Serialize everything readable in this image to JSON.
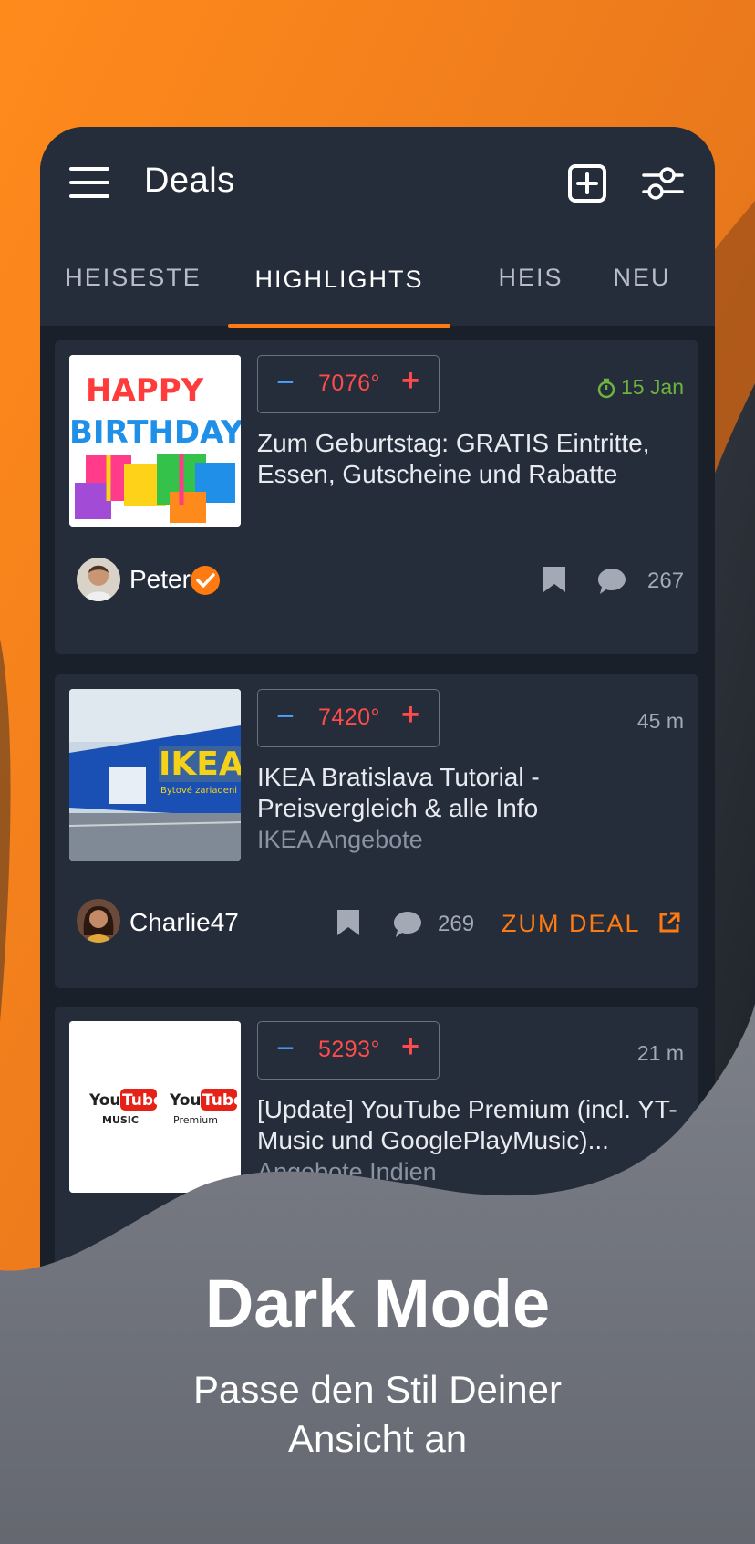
{
  "app": {
    "title": "Deals"
  },
  "tabs": [
    {
      "label": "HEISESTE"
    },
    {
      "label": "HIGHLIGHTS",
      "active": true
    },
    {
      "label": "HEIS"
    },
    {
      "label": "NEU"
    }
  ],
  "deals": [
    {
      "temperature": "7076°",
      "time": "15 Jan",
      "time_has_timer_icon": true,
      "title": "Zum Geburtstag: GRATIS Eintritte, Essen, Gutscheine und Rabatte",
      "thumb_text": [
        "HAPPY",
        "BIRTHDAY"
      ],
      "user": "Peter",
      "verified": true,
      "comments": "267"
    },
    {
      "temperature": "7420°",
      "time": "45 m",
      "title": "IKEA Bratislava Tutorial - Preisvergleich & alle Info",
      "merchant": "IKEA Angebote",
      "thumb_text": [
        "IKEA",
        "Bytové zariadeni"
      ],
      "user": "Charlie47",
      "comments": "269",
      "link_label": "ZUM DEAL"
    },
    {
      "temperature": "5293°",
      "time": "21 m",
      "title": "[Update] YouTube Premium (incl. YT-Music und GooglePlayMusic)...",
      "merchant": "Angebote Indien",
      "thumb_text": [
        "You",
        "Tube",
        "MUSIC",
        "Premium"
      ]
    }
  ],
  "promo": {
    "headline": "Dark Mode",
    "subline": "Passe den Stil Deiner Ansicht an"
  },
  "colors": {
    "accent": "#ff7b12",
    "temperature": "#ff4b4b",
    "vote_minus": "#4aa3ff",
    "background_card": "#252d3a"
  },
  "icons": [
    "menu-icon",
    "add-deal-icon",
    "filter-icon",
    "timer-icon",
    "verified-icon",
    "bookmark-icon",
    "comment-icon",
    "external-link-icon"
  ]
}
